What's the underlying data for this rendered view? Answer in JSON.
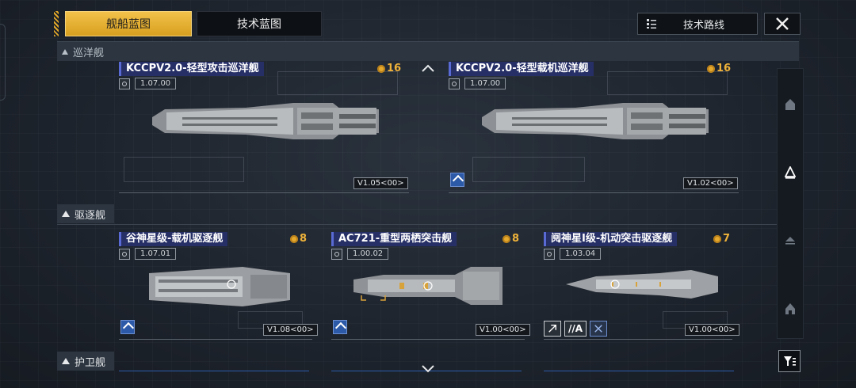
{
  "tabs": {
    "active": "舰船蓝图",
    "inactive": "技术蓝图"
  },
  "route_button": "技术路线",
  "sections": {
    "cruiser": "巡洋舰",
    "destroyer": "驱逐舰",
    "escort": "护卫舰"
  },
  "cards": [
    {
      "title": "KCCPV2.0-轻型攻击巡洋舰",
      "version": "1.07.00",
      "cost": "16",
      "tag": "V1.05<00>"
    },
    {
      "title": "KCCPV2.0-轻型载机巡洋舰",
      "version": "1.07.00",
      "cost": "16",
      "tag": "V1.02<00>"
    },
    {
      "title": "谷神星级-载机驱逐舰",
      "version": "1.07.01",
      "cost": "8",
      "tag": "V1.08<00>"
    },
    {
      "title": "AC721-重型两栖突击舰",
      "version": "1.00.02",
      "cost": "8",
      "tag": "V1.00<00>"
    },
    {
      "title": "阋神星I级-机动突击驱逐舰",
      "version": "1.03.04",
      "cost": "7",
      "tag": "V1.00<00>"
    }
  ],
  "mech_badge": "//A",
  "colors": {
    "accent": "#e8b234",
    "title_bg": "#262f66",
    "cost": "#f0b33a",
    "role_badge": "#2c5aa8"
  },
  "icons": [
    "close-icon",
    "route-list-icon",
    "coin-icon",
    "filter-icon",
    "chevron-up-icon",
    "chevron-down-icon"
  ]
}
